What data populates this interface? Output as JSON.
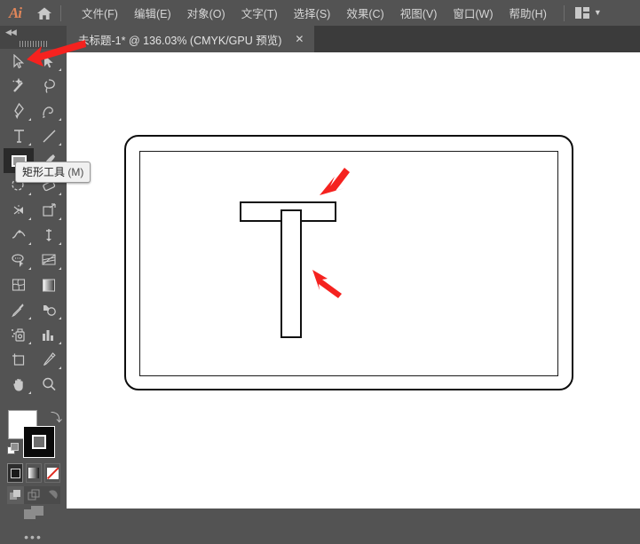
{
  "app": {
    "name": "Adobe Illustrator",
    "logo_text": "Ai",
    "home_icon": "home-icon",
    "arrange_icon": "arrange-documents-icon",
    "arrange_chevron": "▼"
  },
  "menubar": {
    "items": [
      {
        "label": "文件(F)",
        "name": "menu-file"
      },
      {
        "label": "编辑(E)",
        "name": "menu-edit"
      },
      {
        "label": "对象(O)",
        "name": "menu-object"
      },
      {
        "label": "文字(T)",
        "name": "menu-type"
      },
      {
        "label": "选择(S)",
        "name": "menu-select"
      },
      {
        "label": "效果(C)",
        "name": "menu-effect"
      },
      {
        "label": "视图(V)",
        "name": "menu-view"
      },
      {
        "label": "窗口(W)",
        "name": "menu-window"
      },
      {
        "label": "帮助(H)",
        "name": "menu-help"
      }
    ]
  },
  "tabbar": {
    "tab_title": "未标题-1* @ 136.03% (CMYK/GPU 预览)",
    "close_label": "✕",
    "document_name": "未标题-1",
    "modified": true,
    "zoom": "136.03%",
    "color_mode": "CMYK",
    "preview_mode": "GPU 预览"
  },
  "left_panel": {
    "collapse_label": "◀◀",
    "grip": "panel-drag-handle"
  },
  "toolbar": {
    "tools": [
      {
        "name": "selection-tool",
        "icon": "arrow-cursor-icon",
        "has_flyout": false,
        "active": false
      },
      {
        "name": "direct-selection-tool",
        "icon": "white-arrow-cursor-icon",
        "has_flyout": true,
        "active": false
      },
      {
        "name": "magic-wand-tool",
        "icon": "magic-wand-icon",
        "has_flyout": false,
        "active": false
      },
      {
        "name": "lasso-tool",
        "icon": "lasso-icon",
        "has_flyout": false,
        "active": false
      },
      {
        "name": "pen-tool",
        "icon": "pen-icon",
        "has_flyout": true,
        "active": false
      },
      {
        "name": "curvature-tool",
        "icon": "curvature-pen-icon",
        "has_flyout": true,
        "active": false
      },
      {
        "name": "type-tool",
        "icon": "type-T-icon",
        "has_flyout": true,
        "active": false
      },
      {
        "name": "line-segment-tool",
        "icon": "line-segment-icon",
        "has_flyout": true,
        "active": false
      },
      {
        "name": "rectangle-tool",
        "icon": "rectangle-icon",
        "has_flyout": true,
        "active": true
      },
      {
        "name": "paintbrush-tool",
        "icon": "paintbrush-icon",
        "has_flyout": true,
        "active": false
      },
      {
        "name": "shaper-tool",
        "icon": "shaper-icon",
        "has_flyout": true,
        "active": false
      },
      {
        "name": "eraser-tool",
        "icon": "eraser-icon",
        "has_flyout": true,
        "active": false
      },
      {
        "name": "rotate-tool",
        "icon": "rotate-reflect-icon",
        "has_flyout": true,
        "active": false
      },
      {
        "name": "scale-tool",
        "icon": "scale-shear-icon",
        "has_flyout": true,
        "active": false
      },
      {
        "name": "width-tool",
        "icon": "width-warp-icon",
        "has_flyout": true,
        "active": false
      },
      {
        "name": "free-transform-tool",
        "icon": "free-transform-icon",
        "has_flyout": true,
        "active": false
      },
      {
        "name": "shape-builder-tool",
        "icon": "shape-builder-icon",
        "has_flyout": true,
        "active": false
      },
      {
        "name": "perspective-grid-tool",
        "icon": "perspective-grid-icon",
        "has_flyout": true,
        "active": false
      },
      {
        "name": "mesh-tool",
        "icon": "mesh-icon",
        "has_flyout": false,
        "active": false
      },
      {
        "name": "gradient-tool",
        "icon": "gradient-icon",
        "has_flyout": false,
        "active": false
      },
      {
        "name": "eyedropper-tool",
        "icon": "eyedropper-icon",
        "has_flyout": true,
        "active": false
      },
      {
        "name": "blend-tool",
        "icon": "blend-icon",
        "has_flyout": true,
        "active": false
      },
      {
        "name": "symbol-sprayer-tool",
        "icon": "symbol-sprayer-icon",
        "has_flyout": true,
        "active": false
      },
      {
        "name": "column-graph-tool",
        "icon": "bar-graph-icon",
        "has_flyout": true,
        "active": false
      },
      {
        "name": "artboard-tool",
        "icon": "artboard-icon",
        "has_flyout": false,
        "active": false
      },
      {
        "name": "slice-tool",
        "icon": "slice-knife-icon",
        "has_flyout": true,
        "active": false
      },
      {
        "name": "hand-tool",
        "icon": "hand-icon",
        "has_flyout": true,
        "active": false
      },
      {
        "name": "zoom-tool",
        "icon": "magnifier-icon",
        "has_flyout": false,
        "active": false
      }
    ],
    "fill": {
      "name": "fill-swatch",
      "color": "#ffffff"
    },
    "stroke": {
      "name": "stroke-swatch",
      "color": "#000000"
    },
    "swap_icon": "swap-fill-stroke-icon",
    "default_icon": "default-fill-stroke-icon",
    "modes": [
      {
        "name": "color-mode-button",
        "icon": "solid-color-icon",
        "selected": true
      },
      {
        "name": "gradient-mode-button",
        "icon": "gradient-icon",
        "selected": false
      },
      {
        "name": "none-mode-button",
        "icon": "none-slash-icon",
        "selected": false
      }
    ],
    "draw_modes": [
      {
        "name": "draw-normal-button",
        "icon": "draw-normal-icon",
        "selected": true
      },
      {
        "name": "draw-behind-button",
        "icon": "draw-behind-icon",
        "selected": false
      },
      {
        "name": "draw-inside-button",
        "icon": "draw-inside-icon",
        "selected": false
      }
    ],
    "screen_mode": {
      "name": "change-screen-mode-button",
      "icon": "screen-mode-icon"
    },
    "more_label": "•••"
  },
  "tooltip": {
    "visible": true,
    "title": "矩形工具",
    "shortcut": "(M)"
  },
  "canvas": {
    "background": "#ffffff",
    "artboard": {
      "name": "artboard-rounded-frame",
      "stroke": "#0d0d0d"
    },
    "inner_frame": {
      "name": "inner-rectangle-frame",
      "stroke": "#1a1a1a"
    },
    "shapes": [
      {
        "name": "horizontal-rectangle",
        "role": "T-top-bar",
        "stroke": "#111111",
        "fill": "#ffffff"
      },
      {
        "name": "vertical-rectangle",
        "role": "T-stem",
        "stroke": "#111111",
        "fill": "#ffffff"
      }
    ],
    "annotations": [
      {
        "name": "red-arrow-to-horizontal-rect",
        "color": "#f5221f"
      },
      {
        "name": "red-arrow-to-vertical-rect",
        "color": "#f5221f"
      },
      {
        "name": "red-arrow-to-rectangle-tool",
        "color": "#f5221f"
      }
    ]
  }
}
